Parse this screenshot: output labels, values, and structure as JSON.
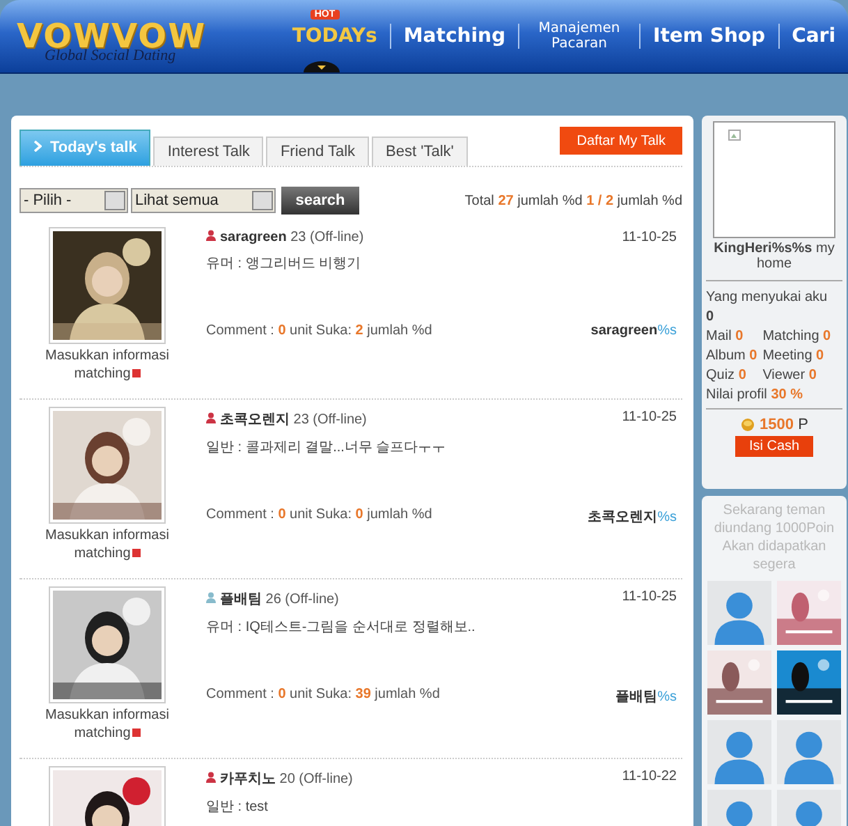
{
  "header": {
    "logo": "VOWVOW",
    "tagline": "Global Social Dating",
    "nav": [
      {
        "label": "TODAYs",
        "selected": true,
        "badge": "HOT"
      },
      {
        "label": "Matching",
        "selected": false
      },
      {
        "label": "Manajemen Pacaran",
        "selected": false
      },
      {
        "label": "Item Shop",
        "selected": false
      },
      {
        "label": "Cari",
        "selected": false
      }
    ]
  },
  "tabs": [
    {
      "label": "Today's talk",
      "selected": true
    },
    {
      "label": "Interest Talk",
      "selected": false
    },
    {
      "label": "Friend Talk",
      "selected": false
    },
    {
      "label": "Best 'Talk'",
      "selected": false
    }
  ],
  "register_button": "Daftar My Talk",
  "filters": {
    "category": "- Pilih -",
    "view": "Lihat semua",
    "search_button": "search"
  },
  "summary": {
    "prefix": "Total",
    "count": "27",
    "unit": "jumlah %d",
    "page": "1",
    "separator": "/",
    "pages": "2",
    "unit_2": "jumlah %d"
  },
  "posts": [
    {
      "name": "saragreen",
      "age": "23",
      "status": "(Off-line)",
      "color": "#cc3344",
      "date": "11-10-25",
      "content": "유머 : 앵그리버드 비행기",
      "comment_label": "Comment :",
      "comments": "0",
      "likes_label": "unit Suka:",
      "likes": "2",
      "likes_unit": "jumlah %d",
      "author": "saragreen",
      "author_suffix": "%s",
      "caption": "Masukkan informasi matching"
    },
    {
      "name": "초콕오렌지",
      "age": "23",
      "status": "(Off-line)",
      "color": "#cc3344",
      "date": "11-10-25",
      "content": "일반 : 콜과제리 결말...너무 슬프다ㅜㅜ",
      "comment_label": "Comment :",
      "comments": "0",
      "likes_label": "unit Suka:",
      "likes": "0",
      "likes_unit": "jumlah %d",
      "author": "초콕오렌지",
      "author_suffix": "%s",
      "caption": "Masukkan informasi matching"
    },
    {
      "name": "플배팀",
      "age": "26",
      "status": "(Off-line)",
      "color": "#88bbcc",
      "date": "11-10-25",
      "content": "유머 : IQ테스트-그림을 순서대로 정렬해보..",
      "comment_label": "Comment :",
      "comments": "0",
      "likes_label": "unit Suka:",
      "likes": "39",
      "likes_unit": "jumlah %d",
      "author": "플배팀",
      "author_suffix": "%s",
      "caption": "Masukkan informasi matching"
    },
    {
      "name": "카푸치노",
      "age": "20",
      "status": "(Off-line)",
      "color": "#cc3344",
      "date": "11-10-22",
      "content": "일반 : test"
    }
  ],
  "profile": {
    "name": "KingHeri%s%s",
    "home": "my home",
    "liked_label": "Yang menyukai aku",
    "liked": "0",
    "stats": [
      {
        "label": "Mail",
        "value": "0"
      },
      {
        "label": "Matching",
        "value": "0"
      },
      {
        "label": "Album",
        "value": "0"
      },
      {
        "label": "Meeting",
        "value": "0"
      },
      {
        "label": "Quiz",
        "value": "0"
      },
      {
        "label": "Viewer",
        "value": "0"
      }
    ],
    "score_label": "Nilai profil",
    "score": "30 %",
    "points": "1500",
    "points_unit": "P",
    "cash_button": "Isi Cash"
  },
  "invite": {
    "text": "Sekarang teman diundang 1000Poin Akan didapatkan segera",
    "friends": [
      {
        "kind": "avatar"
      },
      {
        "kind": "picture"
      },
      {
        "kind": "picture"
      },
      {
        "kind": "picture"
      },
      {
        "kind": "avatar"
      },
      {
        "kind": "avatar"
      },
      {
        "kind": "avatar"
      },
      {
        "kind": "avatar"
      }
    ]
  }
}
